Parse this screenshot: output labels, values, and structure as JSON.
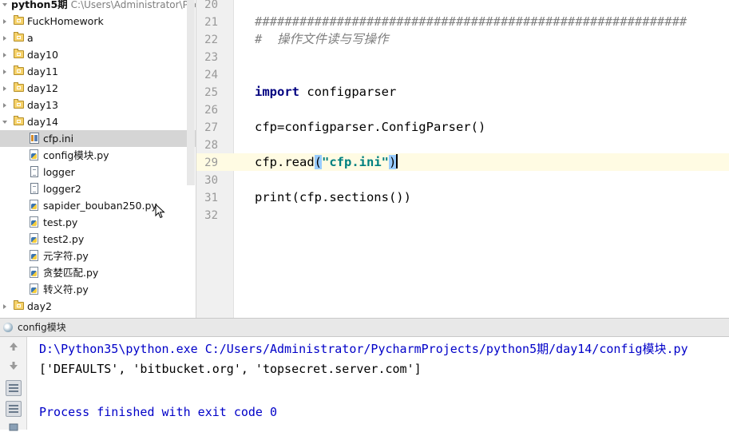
{
  "project": {
    "root_name": "python5期",
    "root_path": "C:\\Users\\Administrator\\PycharmProjects",
    "items": [
      {
        "label": "FuckHomework",
        "kind": "folder"
      },
      {
        "label": "a",
        "kind": "folder"
      },
      {
        "label": "day10",
        "kind": "folder"
      },
      {
        "label": "day11",
        "kind": "folder"
      },
      {
        "label": "day12",
        "kind": "folder"
      },
      {
        "label": "day13",
        "kind": "folder"
      },
      {
        "label": "day14",
        "kind": "folder-open"
      },
      {
        "label": "cfp.ini",
        "kind": "ini",
        "selected": true
      },
      {
        "label": "config模块.py",
        "kind": "py"
      },
      {
        "label": "logger",
        "kind": "txt"
      },
      {
        "label": "logger2",
        "kind": "txt"
      },
      {
        "label": "sapider_bouban250.py",
        "kind": "py"
      },
      {
        "label": "test.py",
        "kind": "py"
      },
      {
        "label": "test2.py",
        "kind": "py"
      },
      {
        "label": "元字符.py",
        "kind": "py"
      },
      {
        "label": "贪婪匹配.py",
        "kind": "py"
      },
      {
        "label": "转义符.py",
        "kind": "py"
      },
      {
        "label": "day2",
        "kind": "folder"
      }
    ]
  },
  "editor": {
    "line_numbers": [
      "20",
      "21",
      "22",
      "23",
      "24",
      "25",
      "26",
      "27",
      "28",
      "29",
      "30",
      "31",
      "32"
    ],
    "current_line": "29",
    "lines": {
      "l21": "##########################################################",
      "l22": "#  操作文件读与写操作",
      "l25_kw": "import",
      "l25_rest": " configparser",
      "l27": "cfp=configparser.ConfigParser()",
      "l29_a": "cfp.read",
      "l29_open": "(",
      "l29_str": "\"cfp.ini\"",
      "l29_close": ")",
      "l31": "print(cfp.sections())"
    }
  },
  "run": {
    "title": "config模块",
    "command": "D:\\Python35\\python.exe C:/Users/Administrator/PycharmProjects/python5期/day14/config模块.py",
    "result": "['DEFAULTS', 'bitbucket.org', 'topsecret.server.com']",
    "exit_message": "Process finished with exit code 0",
    "side_buttons": [
      "up-arrow-icon",
      "down-arrow-icon",
      "wrap-icon",
      "scroll-to-end-icon",
      "print-icon"
    ]
  },
  "colors": {
    "keyword": "#000080",
    "comment": "#808080",
    "string": "#008080",
    "console_path": "#0000c8",
    "current_line": "#fffbe3",
    "brace_match": "#99ccff"
  }
}
